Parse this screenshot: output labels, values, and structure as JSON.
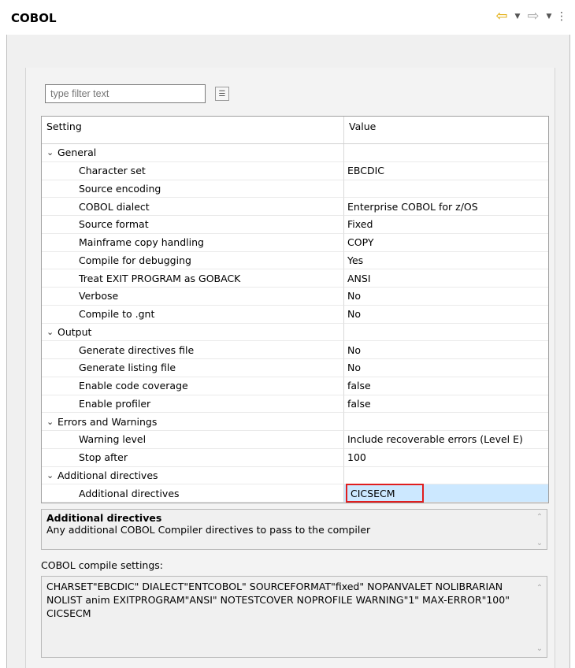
{
  "header": {
    "title": "COBOL"
  },
  "filter": {
    "placeholder": "type filter text"
  },
  "table": {
    "col_setting": "Setting",
    "col_value": "Value",
    "rows": [
      {
        "kind": "cat",
        "label": "General",
        "value": ""
      },
      {
        "kind": "item",
        "label": "Character set",
        "value": "EBCDIC"
      },
      {
        "kind": "item",
        "label": "Source encoding",
        "value": ""
      },
      {
        "kind": "item",
        "label": "COBOL dialect",
        "value": "Enterprise COBOL for z/OS"
      },
      {
        "kind": "item",
        "label": "Source format",
        "value": "Fixed"
      },
      {
        "kind": "item",
        "label": "Mainframe copy handling",
        "value": "COPY"
      },
      {
        "kind": "item",
        "label": "Compile for debugging",
        "value": "Yes"
      },
      {
        "kind": "item",
        "label": "Treat EXIT PROGRAM as GOBACK",
        "value": "ANSI"
      },
      {
        "kind": "item",
        "label": "Verbose",
        "value": "No"
      },
      {
        "kind": "item",
        "label": "Compile to .gnt",
        "value": "No"
      },
      {
        "kind": "cat",
        "label": "Output",
        "value": ""
      },
      {
        "kind": "item",
        "label": "Generate directives file",
        "value": "No"
      },
      {
        "kind": "item",
        "label": "Generate listing file",
        "value": "No"
      },
      {
        "kind": "item",
        "label": "Enable code coverage",
        "value": "false"
      },
      {
        "kind": "item",
        "label": "Enable profiler",
        "value": "false"
      },
      {
        "kind": "cat",
        "label": "Errors and Warnings",
        "value": ""
      },
      {
        "kind": "item",
        "label": "Warning level",
        "value": "Include recoverable errors (Level E)"
      },
      {
        "kind": "item",
        "label": "Stop after",
        "value": "100"
      },
      {
        "kind": "cat",
        "label": "Additional directives",
        "value": ""
      },
      {
        "kind": "item",
        "label": "Additional directives",
        "value": "CICSECM",
        "selected": true
      }
    ]
  },
  "description": {
    "title": "Additional directives",
    "text": "Any additional COBOL Compiler directives to pass to the compiler"
  },
  "compile_settings": {
    "label": "COBOL compile settings:",
    "text": "CHARSET\"EBCDIC\" DIALECT\"ENTCOBOL\" SOURCEFORMAT\"fixed\" NOPANVALET NOLIBRARIAN NOLIST anim EXITPROGRAM\"ANSI\" NOTESTCOVER NOPROFILE WARNING\"1\" MAX-ERROR\"100\" CICSECM"
  },
  "colors": {
    "selection": "#cce8ff",
    "highlight_border": "#e01e1e",
    "back_arrow": "#e0a800"
  }
}
